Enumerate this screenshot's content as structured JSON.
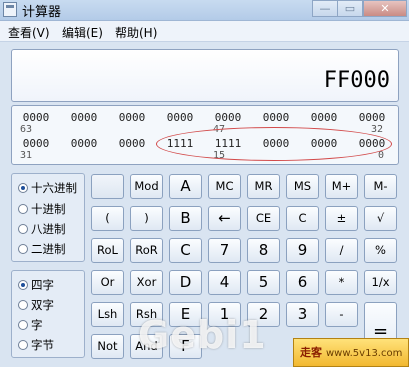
{
  "window": {
    "title": "计算器",
    "minimize_glyph": "—",
    "maximize_glyph": "▭",
    "close_glyph": "✕"
  },
  "menu": [
    "查看(V)",
    "编辑(E)",
    "帮助(H)"
  ],
  "display": {
    "value": "FF000"
  },
  "bit_display": {
    "row1_groups": [
      "0000",
      "0000",
      "0000",
      "0000",
      "0000",
      "0000",
      "0000",
      "0000"
    ],
    "row1_indices": {
      "left": "63",
      "mid": "47",
      "right": "32"
    },
    "row2_groups": [
      "0000",
      "0000",
      "0000",
      "1111",
      "1111",
      "0000",
      "0000",
      "0000"
    ],
    "row2_indices": {
      "left": "31",
      "mid": "15",
      "right": "0"
    }
  },
  "radix_options": [
    {
      "label": "十六进制",
      "selected": true
    },
    {
      "label": "十进制",
      "selected": false
    },
    {
      "label": "八进制",
      "selected": false
    },
    {
      "label": "二进制",
      "selected": false
    }
  ],
  "word_options": [
    {
      "label": "四字",
      "selected": true
    },
    {
      "label": "双字",
      "selected": false
    },
    {
      "label": "字",
      "selected": false
    },
    {
      "label": "字节",
      "selected": false
    }
  ],
  "keys": {
    "r1": [
      "",
      "Mod",
      "A",
      "MC",
      "MR",
      "MS",
      "M+",
      "M-"
    ],
    "r2": [
      "(",
      ")",
      "B",
      "←",
      "CE",
      "C",
      "±",
      "√"
    ],
    "r3": [
      "RoL",
      "RoR",
      "C",
      "7",
      "8",
      "9",
      "/",
      "%"
    ],
    "r4": [
      "Or",
      "Xor",
      "D",
      "4",
      "5",
      "6",
      "*",
      "1/x"
    ],
    "r5": [
      "Lsh",
      "Rsh",
      "E",
      "1",
      "2",
      "3",
      "-"
    ],
    "r6": [
      "Not",
      "And",
      "F"
    ],
    "equals": "="
  },
  "watermark": "Gebi1",
  "stamp": {
    "brand": "走客",
    "url": "www.5v13.com"
  }
}
